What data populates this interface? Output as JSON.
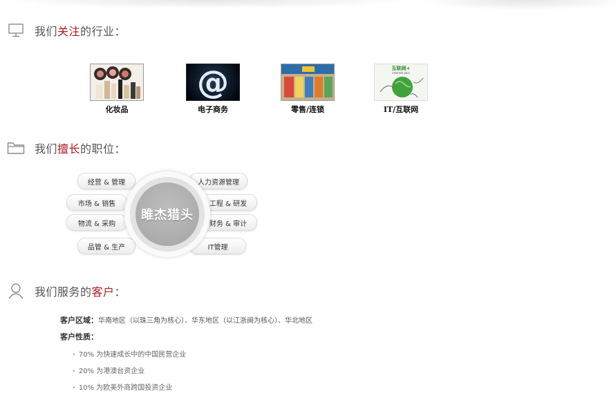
{
  "sections": {
    "industries": {
      "prefix": "我们",
      "highlight": "关注",
      "suffix": "的行业："
    },
    "positions": {
      "prefix": "我们",
      "highlight": "擅长",
      "suffix": "的职位："
    },
    "clients": {
      "prefix": "我们服务的",
      "highlight": "客户",
      "suffix": "："
    }
  },
  "industries": [
    {
      "label": "化妆品"
    },
    {
      "label": "电子商务"
    },
    {
      "label": "零售/连锁"
    },
    {
      "label": "IT/互联网",
      "thumb_text": "互联网+",
      "thumb_subtext": "internet plus"
    }
  ],
  "diagram": {
    "hub": "雎杰猎头",
    "left": [
      "经营 & 管理",
      "市场 & 销售",
      "物流 & 采购",
      "品管 & 生产"
    ],
    "right": [
      "人力资源管理",
      "工程 & 研发",
      "财务 & 审计",
      "IT管理"
    ]
  },
  "clients": {
    "region_label": "客户区域：",
    "region_value": "华南地区（以珠三角为核心）、华东地区（以江浙闽为核心）、华北地区",
    "nature_label": "客户性质：",
    "nature_items": [
      "70% 为快速成长中的中国民营企业",
      "20% 为港澳台资企业",
      "10% 为欧美外商跨国投资企业"
    ]
  },
  "colors": {
    "highlight": "#b01820",
    "icon": "#8a8a8a"
  }
}
